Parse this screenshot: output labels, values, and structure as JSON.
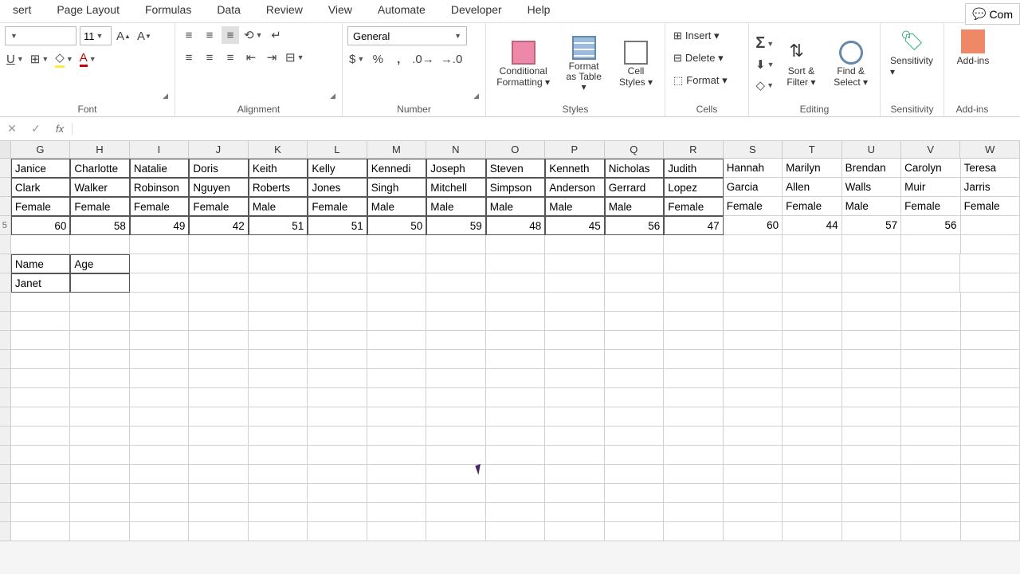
{
  "tabs": [
    "sert",
    "Page Layout",
    "Formulas",
    "Data",
    "Review",
    "View",
    "Automate",
    "Developer",
    "Help"
  ],
  "comments_label": "Com",
  "font": {
    "size": "11",
    "group_label": "Font"
  },
  "alignment": {
    "group_label": "Alignment"
  },
  "number": {
    "format": "General",
    "group_label": "Number"
  },
  "styles": {
    "cond": "Conditional Formatting ▾",
    "table": "Format as Table ▾",
    "cell": "Cell Styles ▾",
    "group_label": "Styles"
  },
  "cells": {
    "insert": "Insert ▾",
    "delete": "Delete ▾",
    "format": "Format ▾",
    "group_label": "Cells"
  },
  "editing": {
    "sort": "Sort & Filter ▾",
    "find": "Find & Select ▾",
    "group_label": "Editing"
  },
  "sensitivity": {
    "label": "Sensitivity ▾",
    "group_label": "Sensitivity"
  },
  "addins": {
    "label": "Add-ins",
    "group_label": "Add-ins"
  },
  "columns": [
    "G",
    "H",
    "I",
    "J",
    "K",
    "L",
    "M",
    "N",
    "O",
    "P",
    "Q",
    "R",
    "S",
    "T",
    "U",
    "V",
    "W"
  ],
  "row1": [
    "Janice",
    "Charlotte",
    "Natalie",
    "Doris",
    "Keith",
    "Kelly",
    "Kennedi",
    "Joseph",
    "Steven",
    "Kenneth",
    "Nicholas",
    "Judith",
    "Hannah",
    "Marilyn",
    "Brendan",
    "Carolyn",
    "Teresa"
  ],
  "row2": [
    "Clark",
    "Walker",
    "Robinson",
    "Nguyen",
    "Roberts",
    "Jones",
    "Singh",
    "Mitchell",
    "Simpson",
    "Anderson",
    "Gerrard",
    "Lopez",
    "Garcia",
    "Allen",
    "Walls",
    "Muir",
    "Jarris"
  ],
  "row3": [
    "Female",
    "Female",
    "Female",
    "Female",
    "Male",
    "Female",
    "Male",
    "Male",
    "Male",
    "Male",
    "Male",
    "Female",
    "Female",
    "Female",
    "Male",
    "Female",
    "Female"
  ],
  "row4_first": "5",
  "row4": [
    "60",
    "58",
    "49",
    "42",
    "51",
    "51",
    "50",
    "59",
    "48",
    "45",
    "56",
    "47",
    "60",
    "44",
    "57",
    "56",
    ""
  ],
  "lookup": {
    "h1": "Name",
    "h2": "Age",
    "v1": "Janet",
    "v2": ""
  },
  "fx_label": "fx"
}
